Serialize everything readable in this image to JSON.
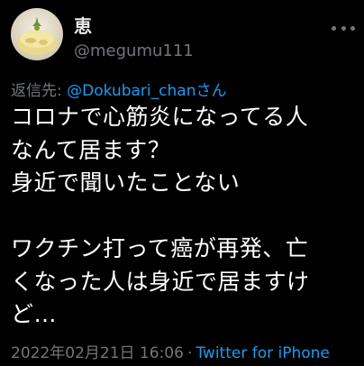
{
  "author": {
    "display_name": "恵",
    "handle": "@megumu111"
  },
  "reply_to": {
    "prefix": "返信先: ",
    "handle": "@Dokubari_chan",
    "suffix": "さん"
  },
  "tweet": {
    "text": "コロナで心筋炎になってる人\nなんて居ます？\n身近で聞いたことない\n\nワクチン打って癌が再発、亡\nくなった人は身近で居ますけ\nど…"
  },
  "meta": {
    "timestamp": "2022年02月21日 16:06",
    "separator": "·",
    "source": "Twitter for iPhone"
  },
  "colors": {
    "background": "#000000",
    "primary_text": "#e7e9ea",
    "secondary_text": "#71767b",
    "link": "#1d9bf0"
  },
  "icons": {
    "more": "more-dots-icon"
  }
}
